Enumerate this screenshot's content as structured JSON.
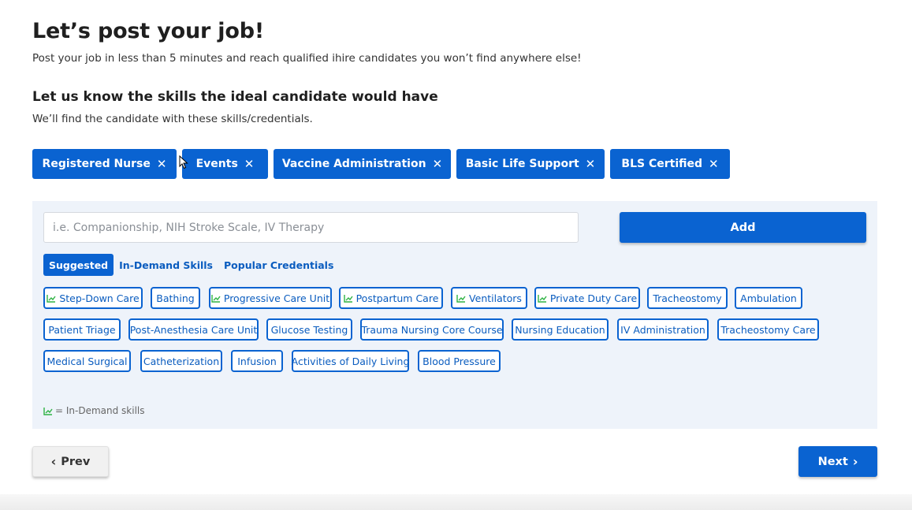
{
  "header": {
    "title": "Let’s post your job!",
    "subtitle": "Post your job in less than 5 minutes and reach qualified ihire candidates you won’t find anywhere else!"
  },
  "skills_section": {
    "title": "Let us know the skills the ideal candidate would have",
    "subtitle": "We’ll find the candidate with these skills/credentials."
  },
  "selected_skills": [
    {
      "label": "Registered Nurse",
      "remove": "✕"
    },
    {
      "label": "Events",
      "remove": "✕"
    },
    {
      "label": "Vaccine Administration",
      "remove": "✕"
    },
    {
      "label": "Basic Life Support",
      "remove": "✕"
    },
    {
      "label": "BLS Certified",
      "remove": "✕"
    }
  ],
  "search": {
    "placeholder": "i.e. Companionship, NIH Stroke Scale, IV Therapy",
    "value": "",
    "add_label": "Add"
  },
  "tabs": [
    {
      "label": "Suggested",
      "active": true
    },
    {
      "label": "In-Demand Skills",
      "active": false
    },
    {
      "label": "Popular Credentials",
      "active": false
    }
  ],
  "suggested_skills": [
    {
      "label": "Step-Down Care",
      "in_demand": true
    },
    {
      "label": "Bathing",
      "in_demand": false
    },
    {
      "label": "Progressive Care Unit",
      "in_demand": true
    },
    {
      "label": "Postpartum Care",
      "in_demand": true
    },
    {
      "label": "Ventilators",
      "in_demand": true
    },
    {
      "label": "Private Duty Care",
      "in_demand": true
    },
    {
      "label": "Tracheostomy",
      "in_demand": false
    },
    {
      "label": "Ambulation",
      "in_demand": false
    },
    {
      "label": "Patient Triage",
      "in_demand": false
    },
    {
      "label": "Post-Anesthesia Care Unit",
      "in_demand": false
    },
    {
      "label": "Glucose Testing",
      "in_demand": false
    },
    {
      "label": "Trauma Nursing Core Course",
      "in_demand": false
    },
    {
      "label": "Nursing Education",
      "in_demand": false
    },
    {
      "label": "IV Administration",
      "in_demand": false
    },
    {
      "label": "Tracheostomy Care",
      "in_demand": false
    },
    {
      "label": "Medical Surgical",
      "in_demand": false
    },
    {
      "label": "Catheterization",
      "in_demand": false
    },
    {
      "label": "Infusion",
      "in_demand": false
    },
    {
      "label": "Activities of Daily Living",
      "in_demand": false
    },
    {
      "label": "Blood Pressure",
      "in_demand": false
    }
  ],
  "legend": {
    "text": "= In-Demand skills"
  },
  "nav": {
    "prev_label": "Prev",
    "next_label": "Next"
  },
  "colors": {
    "primary": "#0a63d1",
    "trend_green": "#2fb344",
    "panel_bg": "#eef3fa"
  },
  "icons": {
    "trend": "trending-up-icon",
    "remove": "close-icon",
    "prev": "chevron-left-icon",
    "next": "chevron-right-icon"
  }
}
